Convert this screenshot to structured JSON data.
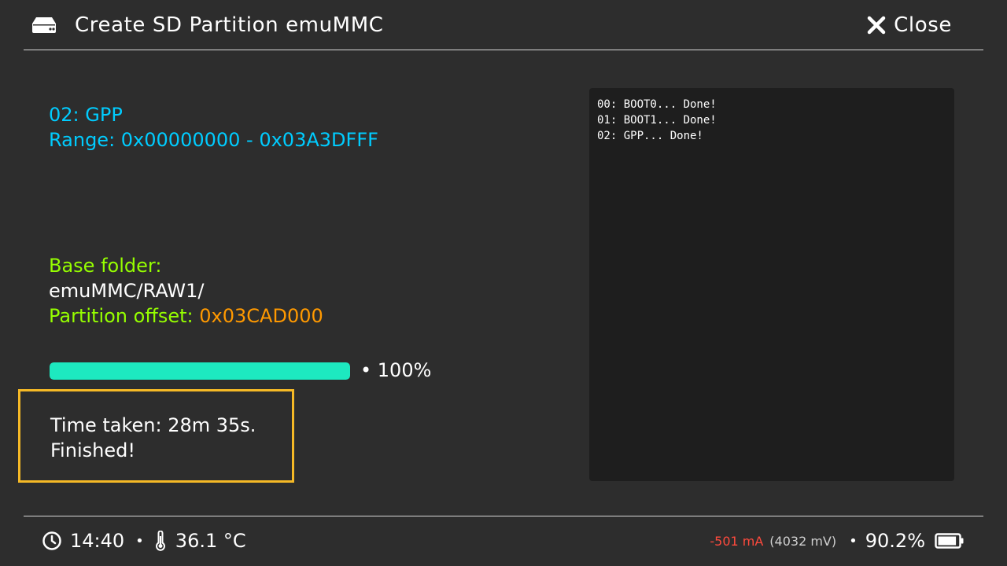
{
  "header": {
    "title": "Create SD Partition emuMMC",
    "close_label": "Close"
  },
  "info": {
    "partition_name": "02: GPP",
    "range": "Range: 0x00000000 - 0x03A3DFFF",
    "base_folder_label": "Base folder:",
    "base_folder_value": "emuMMC/RAW1/",
    "partition_offset_label": "Partition offset:",
    "partition_offset_value": "0x03CAD000"
  },
  "progress": {
    "percent": 100,
    "text": "• 100%"
  },
  "result": {
    "time_taken": "Time taken: 28m 35s.",
    "status": "Finished!"
  },
  "log": {
    "lines": [
      "00: BOOT0... Done!",
      "01: BOOT1... Done!",
      "02: GPP... Done!"
    ]
  },
  "statusbar": {
    "time": "14:40",
    "sep1": "•",
    "temperature": "36.1 °C",
    "current": "-501 mA",
    "voltage": "(4032 mV)",
    "sep2": "•",
    "battery_percent": "90.2%",
    "battery_level": 0.902
  },
  "colors": {
    "background": "#2d2d2d",
    "console_bg": "#1e1e1e",
    "accent_cyan": "#00ccff",
    "accent_green": "#96ff00",
    "accent_orange": "#ff9900",
    "progress_fill": "#1de9c0",
    "highlight_border": "#f5b926",
    "current_red": "#ff4a3d"
  }
}
